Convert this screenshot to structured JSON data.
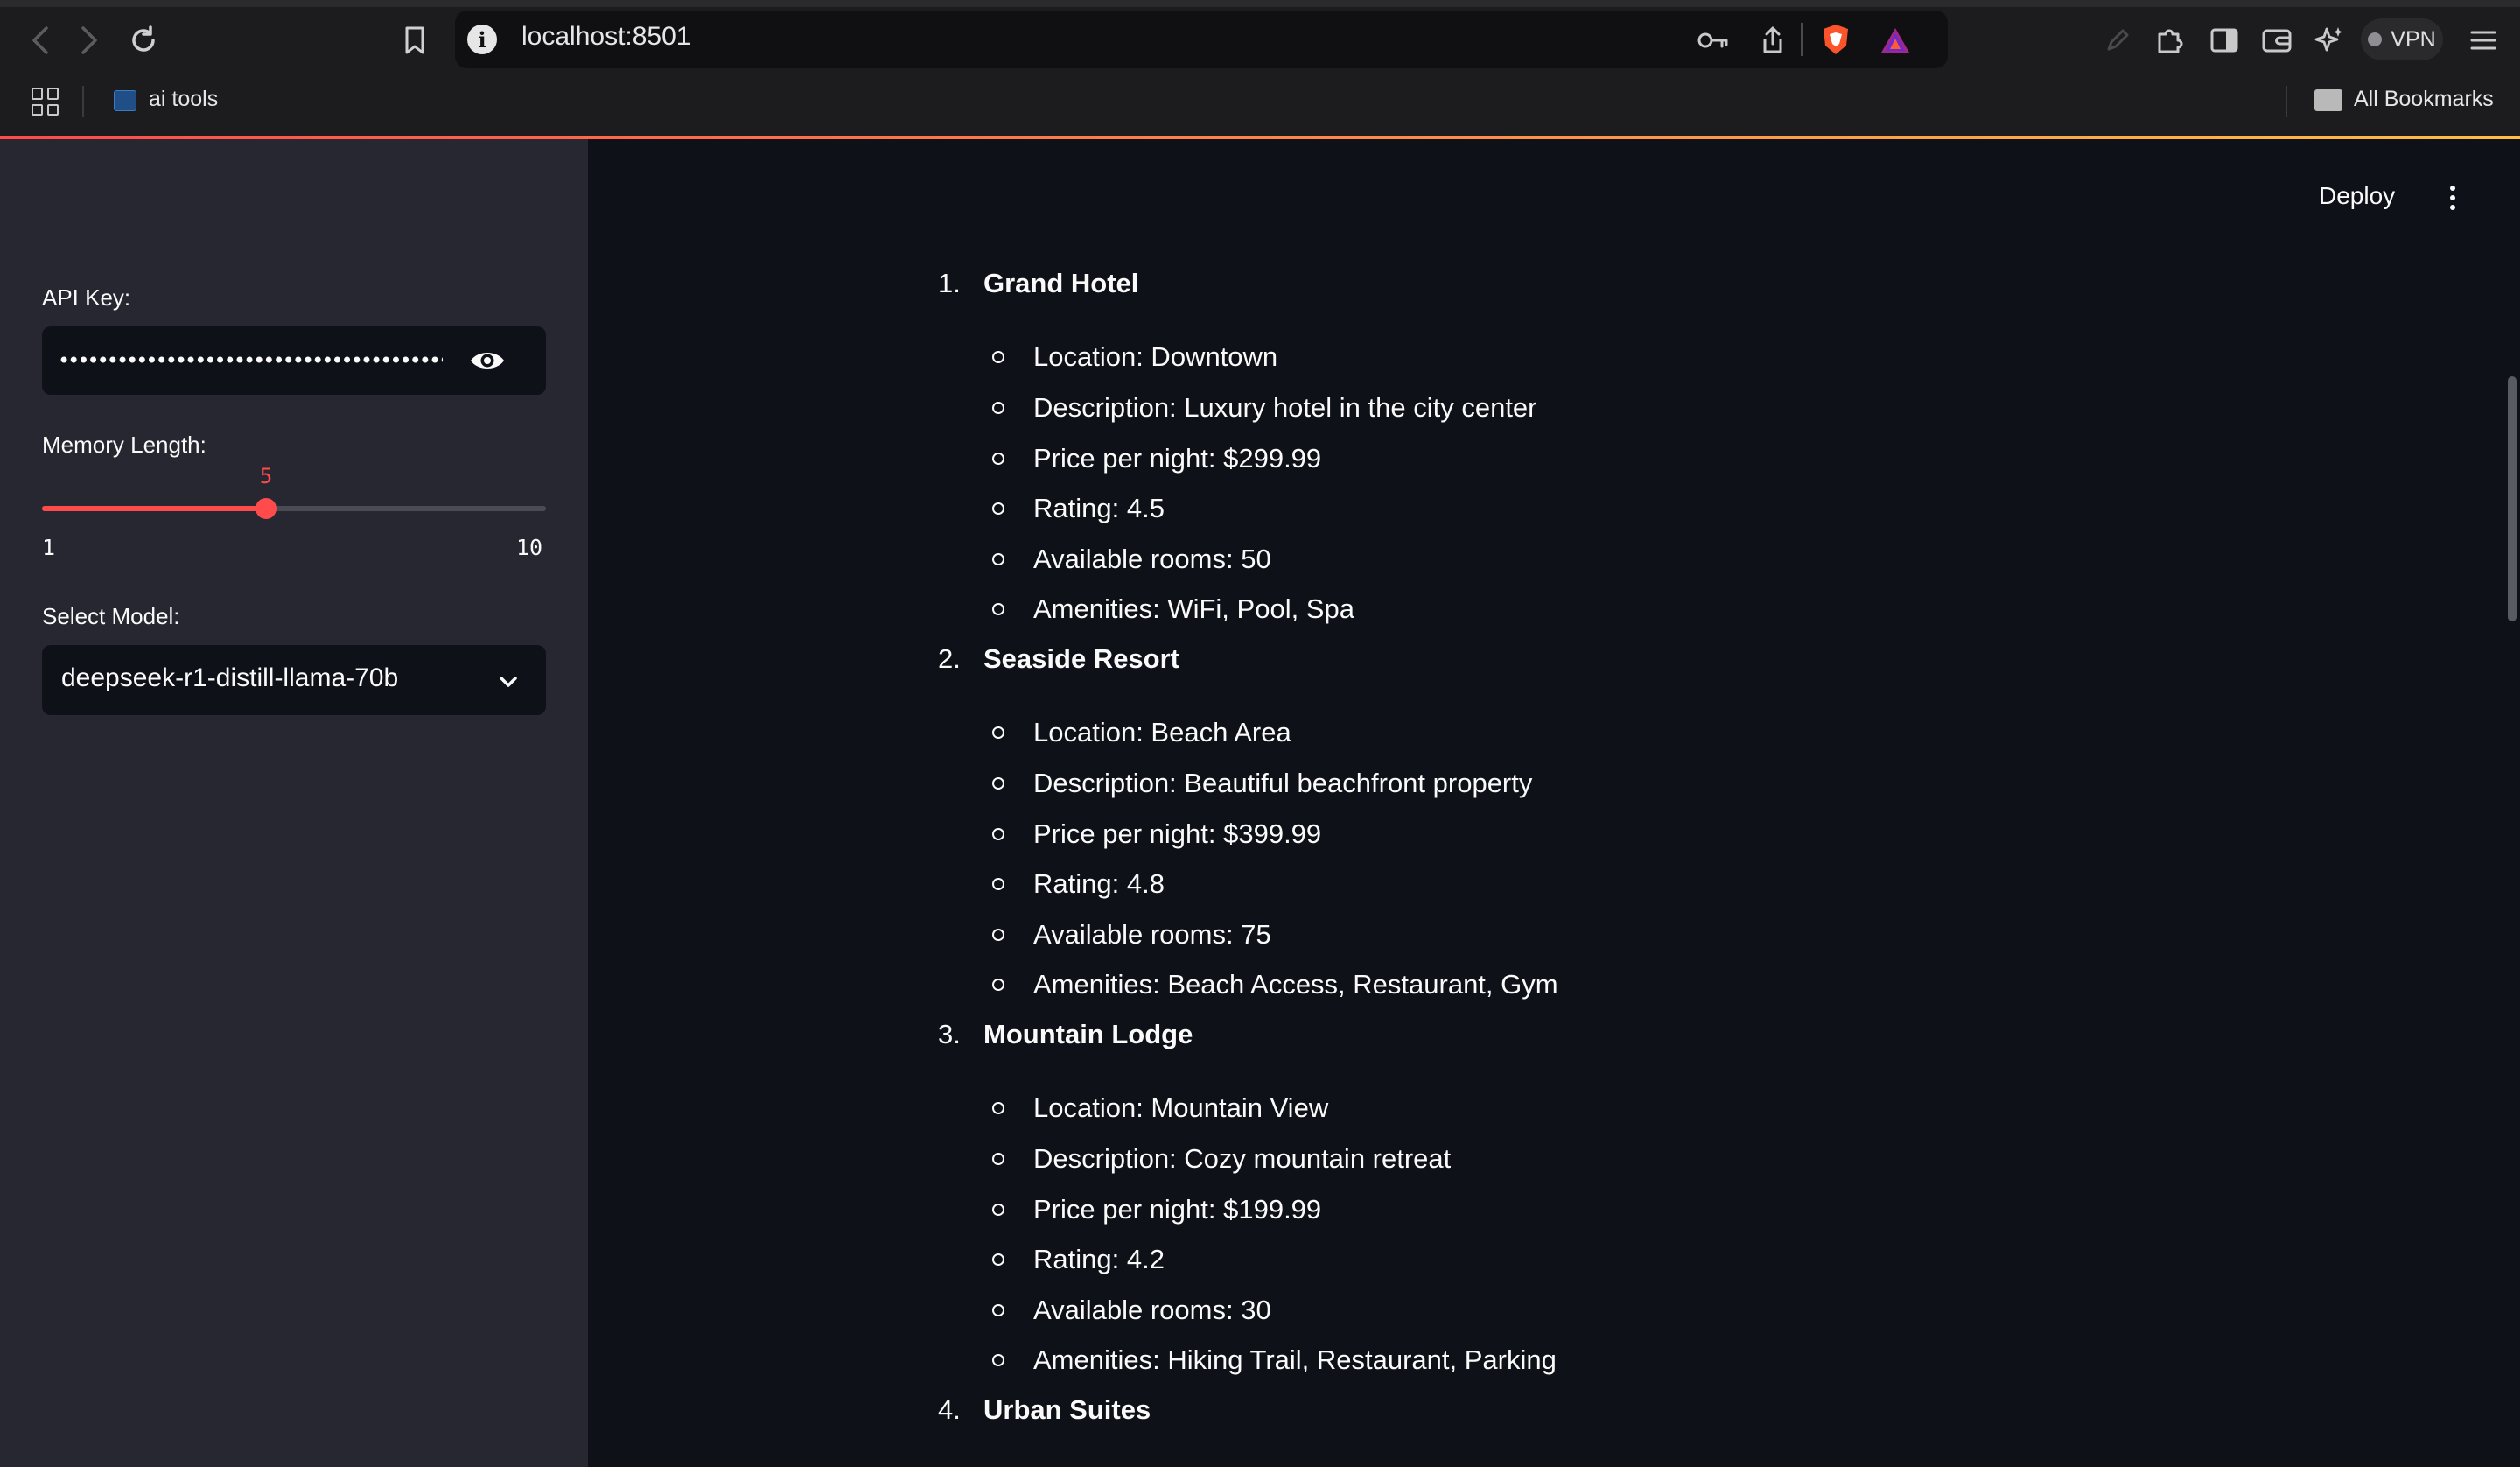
{
  "browser": {
    "url": "localhost:8501",
    "bookmarks": [
      {
        "label": "ai tools"
      }
    ],
    "all_bookmarks_label": "All Bookmarks",
    "vpn_label": "VPN"
  },
  "sidebar": {
    "api_key_label": "API Key:",
    "api_key_masked": "••••••••••••••••••••••••••••••••••••••••••••••••••••••••",
    "memory_label": "Memory Length:",
    "memory_value": "5",
    "memory_min": "1",
    "memory_max": "10",
    "model_label": "Select Model:",
    "model_value": "deepseek-r1-distill-llama-70b"
  },
  "header": {
    "deploy_label": "Deploy"
  },
  "hotels": [
    {
      "number": "1.",
      "name": "Grand Hotel",
      "details": [
        "Location: Downtown",
        "Description: Luxury hotel in the city center",
        "Price per night: $299.99",
        "Rating: 4.5",
        "Available rooms: 50",
        "Amenities: WiFi, Pool, Spa"
      ]
    },
    {
      "number": "2.",
      "name": "Seaside Resort",
      "details": [
        "Location: Beach Area",
        "Description: Beautiful beachfront property",
        "Price per night: $399.99",
        "Rating: 4.8",
        "Available rooms: 75",
        "Amenities: Beach Access, Restaurant, Gym"
      ]
    },
    {
      "number": "3.",
      "name": "Mountain Lodge",
      "details": [
        "Location: Mountain View",
        "Description: Cozy mountain retreat",
        "Price per night: $199.99",
        "Rating: 4.2",
        "Available rooms: 30",
        "Amenities: Hiking Trail, Restaurant, Parking"
      ]
    },
    {
      "number": "4.",
      "name": "Urban Suites",
      "details": []
    }
  ]
}
